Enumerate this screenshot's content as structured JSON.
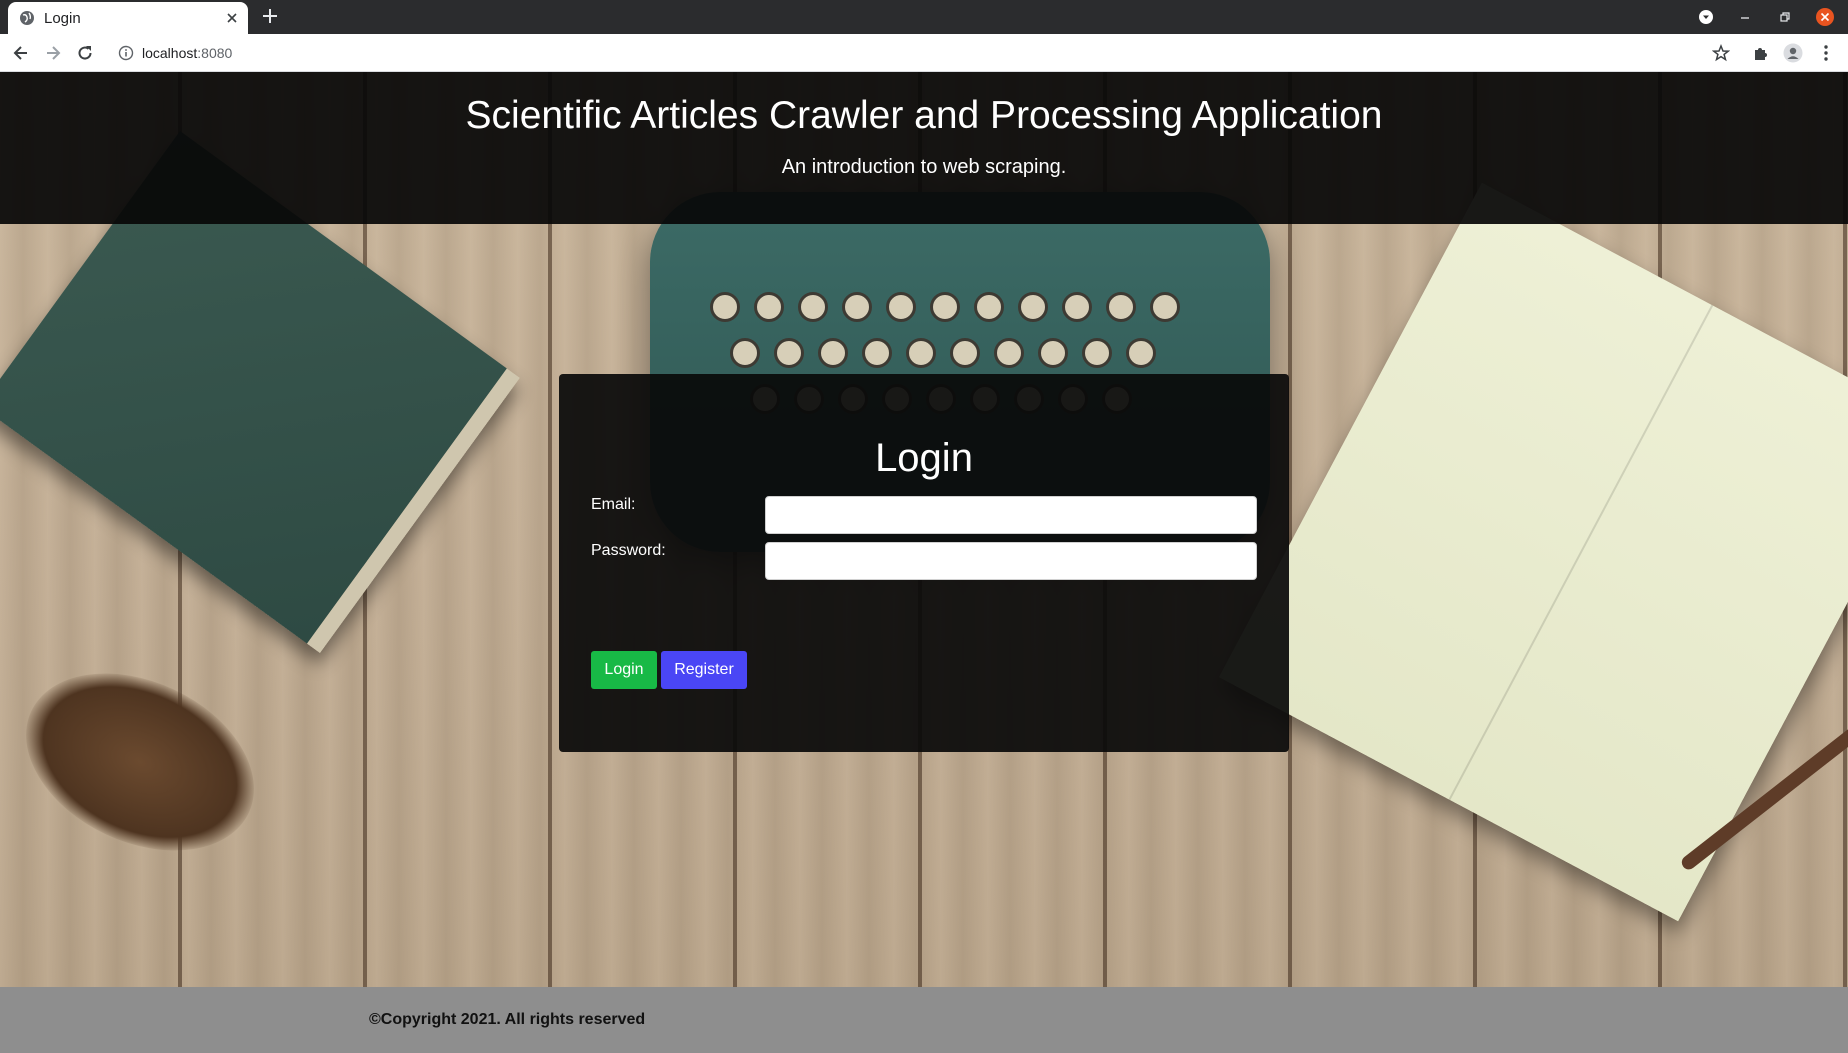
{
  "browser": {
    "tab_title": "Login",
    "url_host": "localhost",
    "url_port": ":8080",
    "icons": {
      "favicon": "globe-icon",
      "tab_close": "close-icon",
      "new_tab": "plus-icon",
      "back": "back-arrow-icon",
      "forward": "forward-arrow-icon",
      "reload": "reload-icon",
      "site_info": "info-icon",
      "bookmark": "star-icon",
      "extensions": "puzzle-icon",
      "profile": "profile-icon",
      "menu": "kebab-menu-icon",
      "tab_search": "tab-search-icon",
      "minimize": "minimize-icon",
      "restore": "restore-icon",
      "close_window": "close-window-icon"
    }
  },
  "header": {
    "title": "Scientific Articles Crawler and Processing Application",
    "subtitle": "An introduction to web scraping."
  },
  "login_form": {
    "title": "Login",
    "email_label": "Email:",
    "email_value": "",
    "password_label": "Password:",
    "password_value": "",
    "login_button": "Login",
    "register_button": "Register"
  },
  "footer": {
    "copyright": "©Copyright 2021. All rights reserved"
  },
  "colors": {
    "login_button": "#18b946",
    "register_button": "#4a46f5",
    "header_bg": "#080808",
    "footer_bg": "#8e8e8e"
  }
}
